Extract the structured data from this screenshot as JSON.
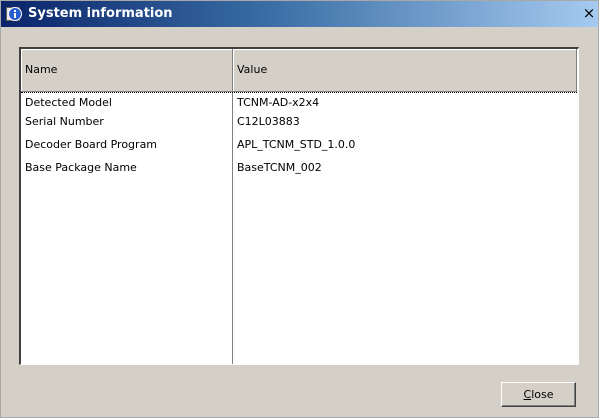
{
  "window": {
    "title": "System information",
    "close_glyph": "×",
    "title_icon": "info-icon"
  },
  "table": {
    "columns": [
      "Name",
      "Value"
    ],
    "rows": [
      {
        "name": "Detected Model",
        "value": "TCNM-AD-x2x4"
      },
      {
        "name": "Serial Number",
        "value": "C12L03883"
      },
      {
        "name": "Decoder Board Program",
        "value": "APL_TCNM_STD_1.0.0"
      },
      {
        "name": "Base Package Name",
        "value": "BaseTCNM_002"
      }
    ]
  },
  "footer": {
    "close_label_mnemonic": "C",
    "close_label_rest": "lose"
  },
  "colors": {
    "titlebar_start": "#0a246a",
    "titlebar_end": "#a6caf0",
    "dialog_bg": "#d4d0c8"
  }
}
